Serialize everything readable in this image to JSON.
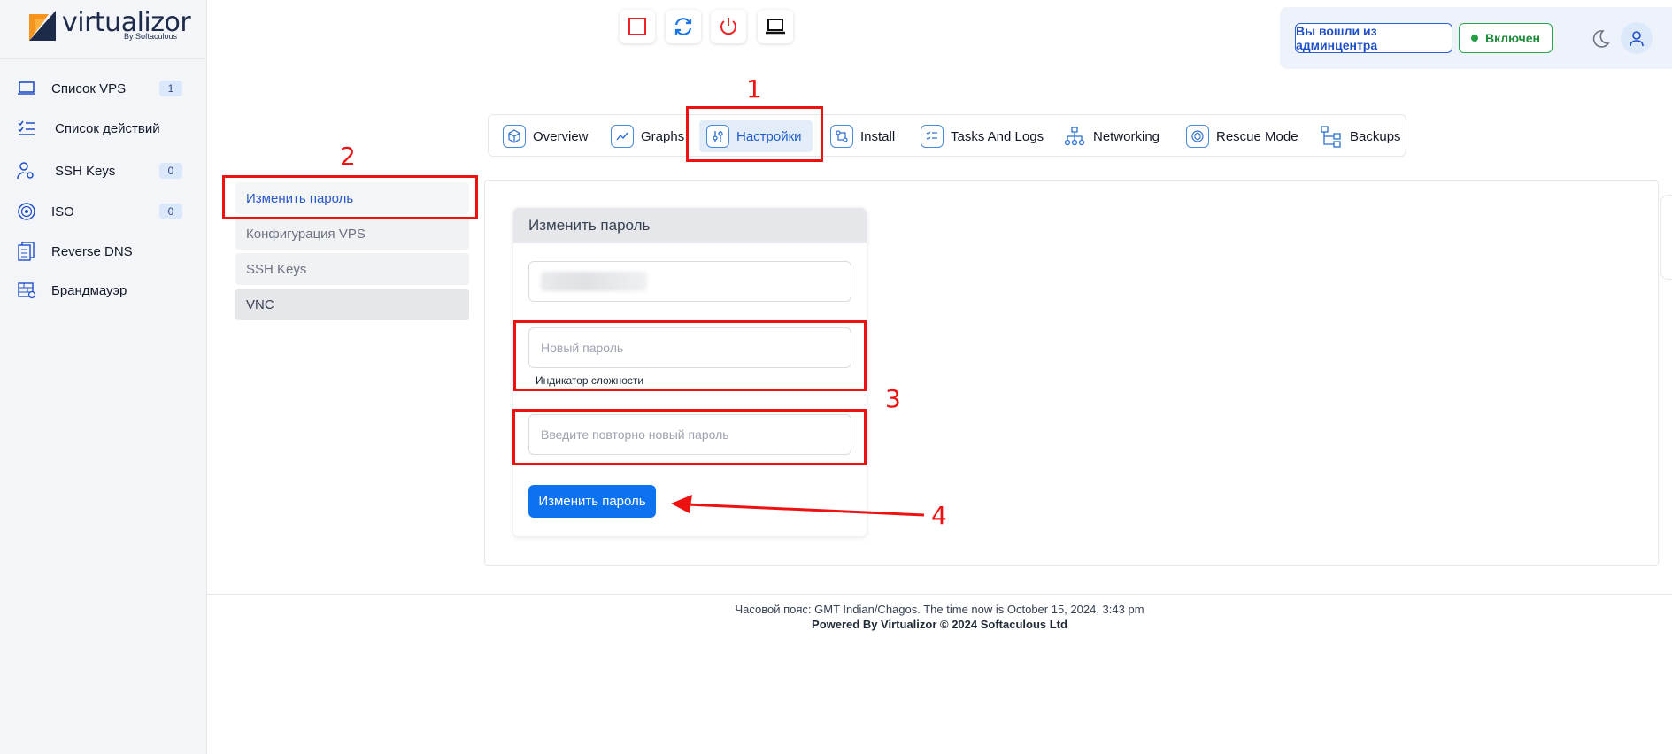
{
  "logo": {
    "name": "virtualizor",
    "sub": "By Softaculous"
  },
  "sidebar": {
    "items": [
      {
        "label": "Список VPS",
        "count": "1",
        "icon": "laptop-icon"
      },
      {
        "label": "Список действий",
        "icon": "checklist-icon"
      },
      {
        "label": "SSH Keys",
        "count": "0",
        "icon": "user-key-icon"
      },
      {
        "label": "ISO",
        "count": "0",
        "icon": "disc-icon"
      },
      {
        "label": "Reverse DNS",
        "icon": "dns-icon"
      },
      {
        "label": "Брандмауэр",
        "icon": "firewall-icon"
      }
    ]
  },
  "controls": [
    "stop-icon",
    "restart-icon",
    "power-icon",
    "console-icon"
  ],
  "header": {
    "admin_label": "Вы вошли из админцентра",
    "status_label": "Включен"
  },
  "tabs": [
    {
      "label": "Overview"
    },
    {
      "label": "Graphs"
    },
    {
      "label": "Настройки"
    },
    {
      "label": "Install"
    },
    {
      "label": "Tasks And Logs"
    },
    {
      "label": "Networking"
    },
    {
      "label": "Rescue Mode"
    },
    {
      "label": "Backups"
    }
  ],
  "submenu": [
    "Изменить пароль",
    "Конфигурация VPS",
    "SSH Keys",
    "VNC"
  ],
  "card": {
    "title": "Изменить пароль",
    "new_password_placeholder": "Новый пароль",
    "strength_label": "Индикатор сложности",
    "repeat_placeholder": "Введите повторно новый пароль",
    "submit_label": "Изменить пароль"
  },
  "footer": {
    "line1": "Часовой пояс: GMT Indian/Chagos. The time now is October 15, 2024, 3:43 pm",
    "line2": "Powered By Virtualizor © 2024 Softaculous Ltd"
  },
  "annotations": [
    "1",
    "2",
    "3",
    "4"
  ],
  "colors": {
    "accent": "#0d72ef",
    "annotation": "#ee1111",
    "status": "#22a045"
  }
}
